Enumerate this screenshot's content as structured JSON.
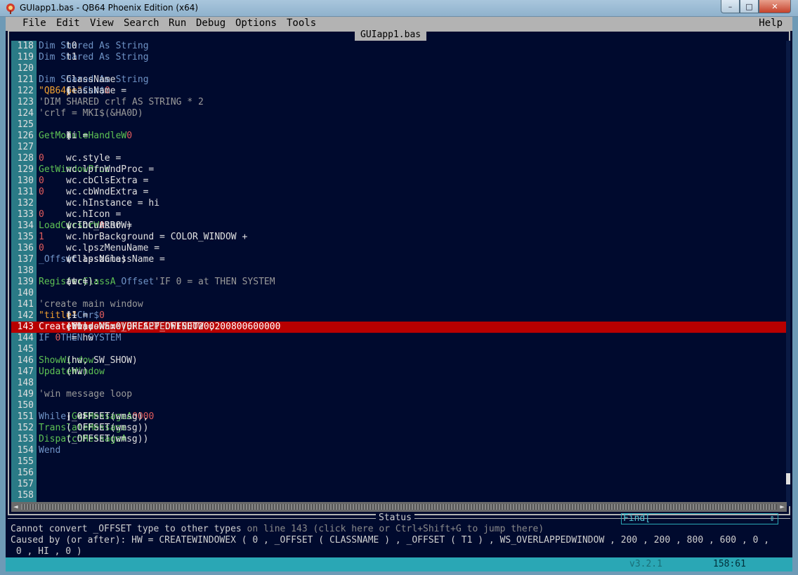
{
  "window": {
    "title": "GUIapp1.bas - QB64 Phoenix Edition (x64)",
    "minimize_glyph": "–",
    "maximize_glyph": "□",
    "close_glyph": "✕"
  },
  "menu": {
    "items": [
      "File",
      "Edit",
      "View",
      "Search",
      "Run",
      "Debug",
      "Options",
      "Tools"
    ],
    "help": "Help"
  },
  "editor": {
    "file_tab": "GUIapp1.bas",
    "error_line": 143,
    "lines": [
      {
        "n": "118",
        "parts": [
          [
            "kw",
            "Dim Shared "
          ],
          [
            "txt",
            "t0 "
          ],
          [
            "kw",
            "As String"
          ]
        ]
      },
      {
        "n": "119",
        "parts": [
          [
            "kw",
            "Dim Shared "
          ],
          [
            "txt",
            "t1 "
          ],
          [
            "kw",
            "As String"
          ]
        ]
      },
      {
        "n": "120",
        "parts": []
      },
      {
        "n": "121",
        "parts": [
          [
            "kw",
            "Dim Shared "
          ],
          [
            "txt",
            "ClassName "
          ],
          [
            "kw",
            "As String"
          ]
        ]
      },
      {
        "n": "122",
        "parts": [
          [
            "txt",
            "ClassName = "
          ],
          [
            "str",
            "\"QB64pe\""
          ],
          [
            "txt",
            " + "
          ],
          [
            "kw",
            "Chr$"
          ],
          [
            "txt",
            "("
          ],
          [
            "num",
            "0"
          ],
          [
            "txt",
            ")"
          ]
        ]
      },
      {
        "n": "123",
        "parts": [
          [
            "cm",
            "'DIM SHARED crlf AS STRING * 2"
          ]
        ]
      },
      {
        "n": "124",
        "parts": [
          [
            "cm",
            "'crlf = MKI$(&HA0D)"
          ]
        ]
      },
      {
        "n": "125",
        "parts": []
      },
      {
        "n": "126",
        "parts": [
          [
            "txt",
            "hi = "
          ],
          [
            "fn",
            "GetModuleHandleW"
          ],
          [
            "txt",
            "("
          ],
          [
            "num",
            "0"
          ],
          [
            "txt",
            ")"
          ]
        ]
      },
      {
        "n": "127",
        "parts": []
      },
      {
        "n": "128",
        "parts": [
          [
            "txt",
            "wc.style = "
          ],
          [
            "num",
            "0"
          ]
        ]
      },
      {
        "n": "129",
        "parts": [
          [
            "txt",
            "wc.lpfnWndProc = "
          ],
          [
            "fn",
            "GetWindowProc"
          ]
        ]
      },
      {
        "n": "130",
        "parts": [
          [
            "txt",
            "wc.cbClsExtra = "
          ],
          [
            "num",
            "0"
          ]
        ]
      },
      {
        "n": "131",
        "parts": [
          [
            "txt",
            "wc.cbWndExtra = "
          ],
          [
            "num",
            "0"
          ]
        ]
      },
      {
        "n": "132",
        "parts": [
          [
            "txt",
            "wc.hInstance = hi"
          ]
        ]
      },
      {
        "n": "133",
        "parts": [
          [
            "txt",
            "wc.hIcon = "
          ],
          [
            "num",
            "0"
          ]
        ]
      },
      {
        "n": "134",
        "parts": [
          [
            "txt",
            "wc.hCursor = "
          ],
          [
            "fn",
            "LoadCursorW"
          ],
          [
            "txt",
            "("
          ],
          [
            "num",
            "0"
          ],
          [
            "txt",
            ", IDC_ARROW)"
          ]
        ]
      },
      {
        "n": "135",
        "parts": [
          [
            "txt",
            "wc.hbrBackground = COLOR_WINDOW + "
          ],
          [
            "num",
            "1"
          ]
        ]
      },
      {
        "n": "136",
        "parts": [
          [
            "txt",
            "wc.lpszMenuName = "
          ],
          [
            "num",
            "0"
          ]
        ]
      },
      {
        "n": "137",
        "parts": [
          [
            "txt",
            "wc.lpszClassName = "
          ],
          [
            "kw",
            "_Offset"
          ],
          [
            "txt",
            "(ClassName)"
          ]
        ]
      },
      {
        "n": "138",
        "parts": []
      },
      {
        "n": "139",
        "parts": [
          [
            "txt",
            "at = "
          ],
          [
            "fn",
            "RegisterClassA"
          ],
          [
            "txt",
            "("
          ],
          [
            "kw",
            "_Offset"
          ],
          [
            "txt",
            "(wc)): "
          ],
          [
            "cm",
            "'IF 0 = at THEN SYSTEM"
          ]
        ]
      },
      {
        "n": "140",
        "parts": []
      },
      {
        "n": "141",
        "parts": [
          [
            "cm",
            "'create main window"
          ]
        ]
      },
      {
        "n": "142",
        "parts": [
          [
            "txt",
            "t1 = "
          ],
          [
            "str",
            "\"title\""
          ],
          [
            "txt",
            " + "
          ],
          [
            "kw",
            "Chr$"
          ],
          [
            "txt",
            "("
          ],
          [
            "num",
            "0"
          ],
          [
            "txt",
            ")"
          ]
        ]
      },
      {
        "n": "143",
        "parts": [
          [
            "txt",
            " hw = "
          ],
          [
            "fn",
            "CreateWindowEx"
          ],
          [
            "txt",
            "("
          ],
          [
            "num",
            "0"
          ],
          [
            "txt",
            ", "
          ],
          [
            "kw",
            "_OFFSET"
          ],
          [
            "txt",
            "(ClassName), "
          ],
          [
            "kw",
            "_OFFSET"
          ],
          [
            "txt",
            "(t1), WS_OVERLAPPEDWINDOW , "
          ],
          [
            "num",
            "200"
          ],
          [
            "txt",
            ", "
          ],
          [
            "num",
            "200"
          ],
          [
            "txt",
            ", "
          ],
          [
            "num",
            "800"
          ],
          [
            "txt",
            ", "
          ],
          [
            "num",
            "600"
          ],
          [
            "txt",
            ", "
          ],
          [
            "num",
            "0"
          ],
          [
            "txt",
            ", "
          ],
          [
            "num",
            "0"
          ],
          [
            "txt",
            ", hi, "
          ],
          [
            "num",
            "0"
          ],
          [
            "txt",
            ")"
          ]
        ]
      },
      {
        "n": "144",
        "parts": [
          [
            "txt",
            " "
          ],
          [
            "kw",
            "IF "
          ],
          [
            "num",
            "0"
          ],
          [
            "txt",
            " = hw "
          ],
          [
            "kw",
            "THEN SYSTEM"
          ]
        ]
      },
      {
        "n": "145",
        "parts": []
      },
      {
        "n": "146",
        "parts": [
          [
            "fn",
            "ShowWindow"
          ],
          [
            "txt",
            "(hw, SW_SHOW)"
          ]
        ]
      },
      {
        "n": "147",
        "parts": [
          [
            "fn",
            "UpdateWindow"
          ],
          [
            "txt",
            "(hw)"
          ]
        ]
      },
      {
        "n": "148",
        "parts": []
      },
      {
        "n": "149",
        "parts": [
          [
            "cm",
            "'win message loop"
          ]
        ]
      },
      {
        "n": "150",
        "parts": []
      },
      {
        "n": "151",
        "parts": [
          [
            "txt",
            "  "
          ],
          [
            "kw",
            "While "
          ],
          [
            "fn",
            "GetMessageA"
          ],
          [
            "txt",
            "(_OFFSET(wmsg), "
          ],
          [
            "num",
            "0"
          ],
          [
            "txt",
            ", "
          ],
          [
            "num",
            "0"
          ],
          [
            "txt",
            ", "
          ],
          [
            "num",
            "0"
          ],
          [
            "txt",
            ") <> "
          ],
          [
            "num",
            "0"
          ]
        ]
      },
      {
        "n": "152",
        "parts": [
          [
            "txt",
            "          "
          ],
          [
            "fn",
            "TranslateMessage"
          ],
          [
            "txt",
            "(_OFFSET(wmsg))"
          ]
        ]
      },
      {
        "n": "153",
        "parts": [
          [
            "txt",
            "           "
          ],
          [
            "fn",
            "DispatchMessageA"
          ],
          [
            "txt",
            "(_OFFSET(wmsg))"
          ]
        ]
      },
      {
        "n": "154",
        "parts": [
          [
            "txt",
            "       "
          ],
          [
            "kw",
            "Wend"
          ]
        ]
      },
      {
        "n": "155",
        "parts": []
      },
      {
        "n": "156",
        "parts": []
      },
      {
        "n": "157",
        "parts": []
      },
      {
        "n": "158",
        "parts": []
      }
    ]
  },
  "status": {
    "title": "Status",
    "find_label": "Find[",
    "find_arrows": "⇕",
    "message_main": "Cannot convert _OFFSET type to other types",
    "message_hint": " on line 143 (click here or Ctrl+Shift+G to jump there)",
    "caused_by": "Caused by (or after): HW = CREATEWINDOWEX ( 0 , _OFFSET ( CLASSNAME ) , _OFFSET ( T1 ) , WS_OVERLAPPEDWINDOW , 200 , 200 , 800 , 600 , 0 ,",
    "caused_by_cont": " 0 , HI , 0 )"
  },
  "footer": {
    "version": "v3.2.1",
    "cursor_position": "158:61"
  },
  "colors": {
    "editor_bg": "#000a2e",
    "gutter": "#2a7a86",
    "error_line": "#b80000",
    "keyword": "#6f93c6",
    "string": "#f0a030",
    "number": "#e25c5c",
    "function": "#5ec254",
    "comment": "#9a9a9a",
    "status_bar": "#2aa7b5"
  }
}
